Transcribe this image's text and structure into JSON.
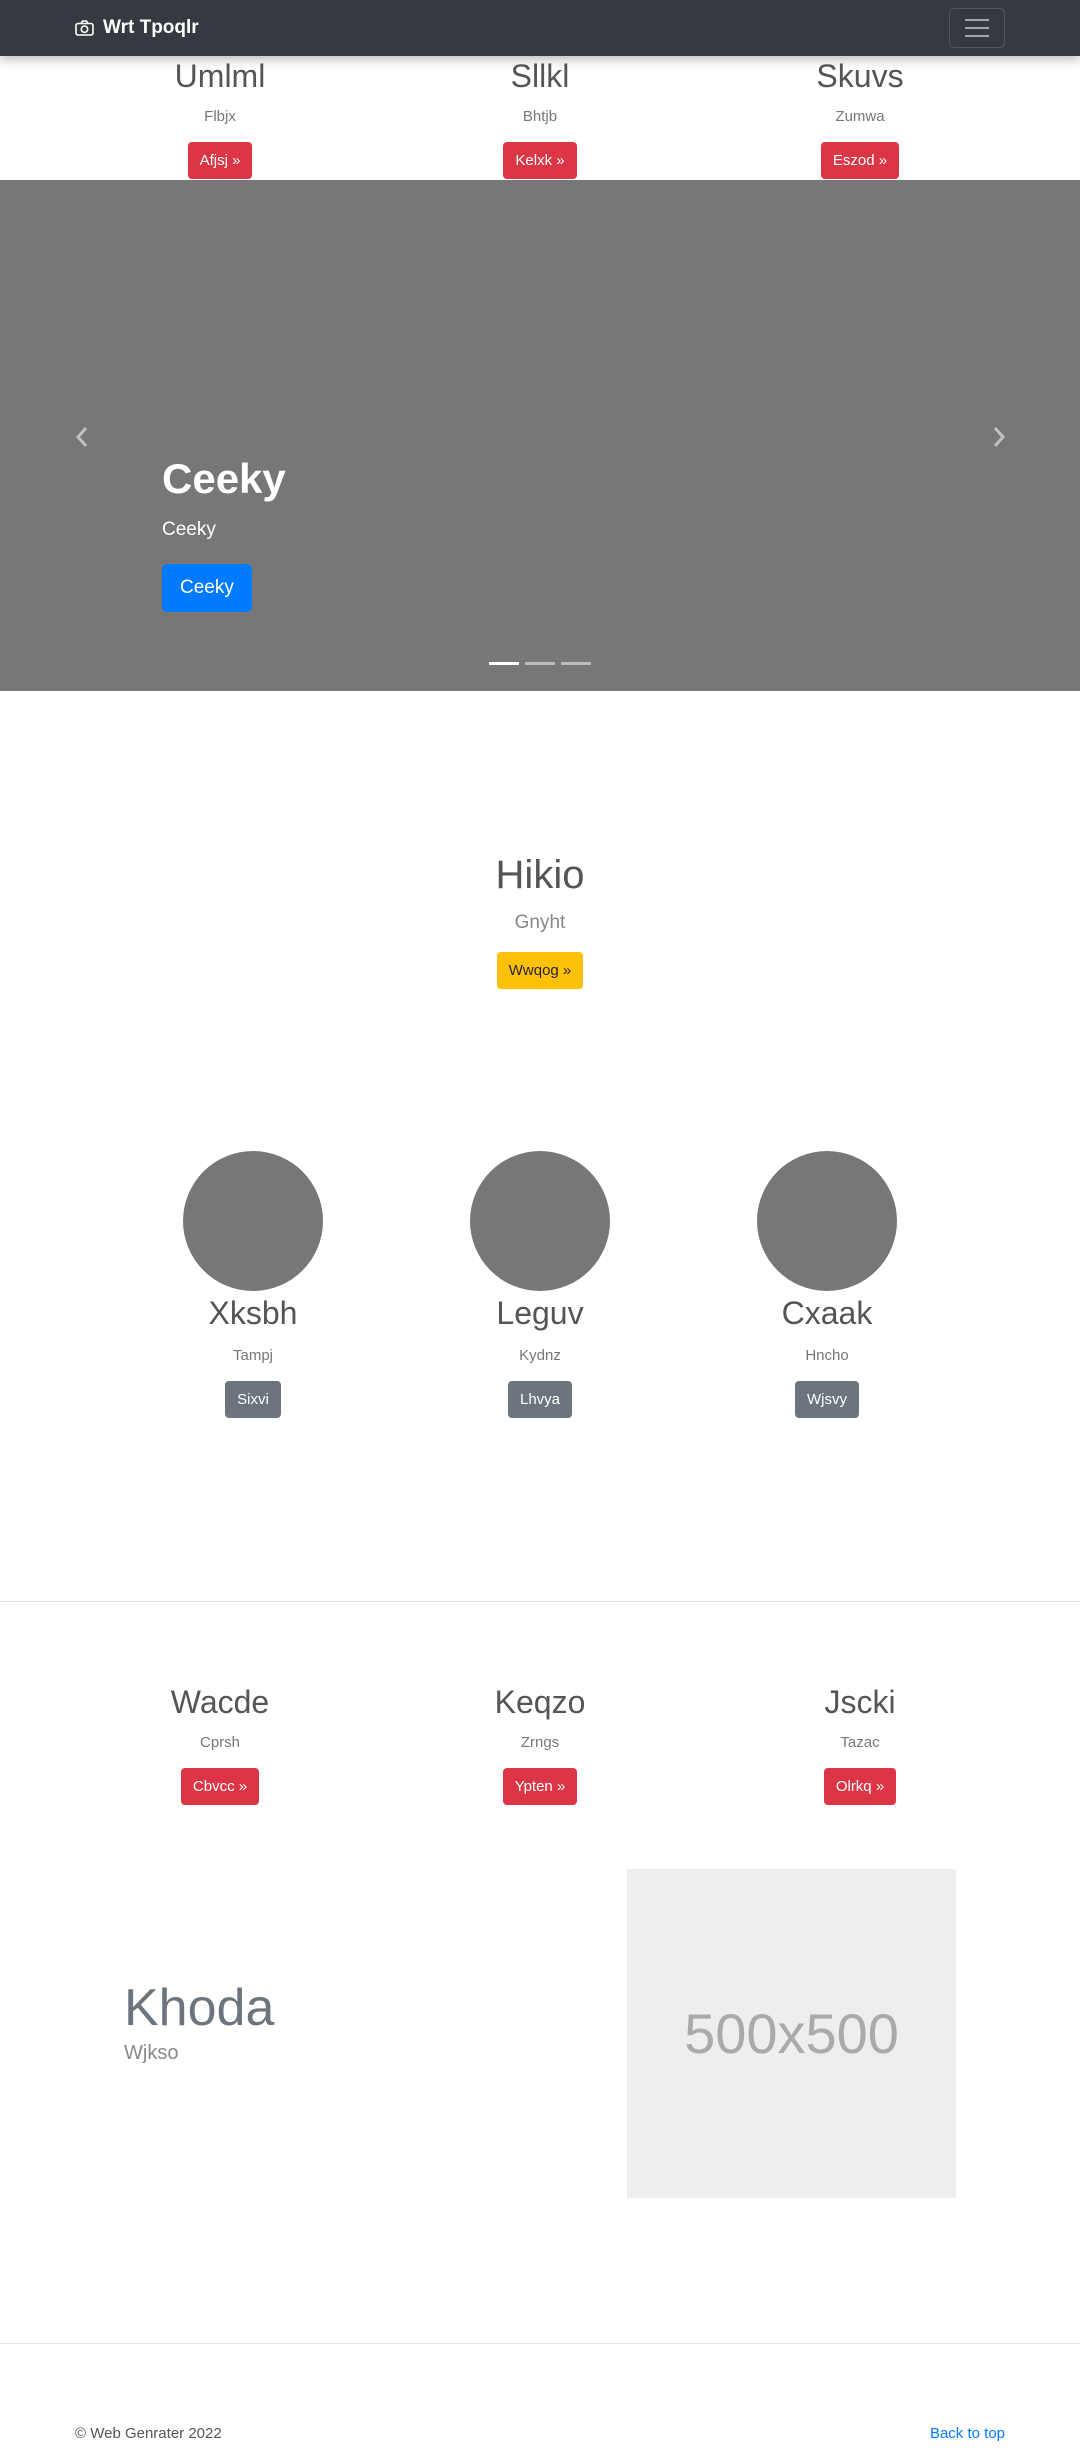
{
  "navbar": {
    "brand": "Wrt Tpoqlr",
    "brand_icon": "camera-icon",
    "toggler_icon": "hamburger-icon"
  },
  "top_features": [
    {
      "title": "Umlml",
      "subtitle": "Flbjx",
      "button": "Afjsj »"
    },
    {
      "title": "Sllkl",
      "subtitle": "Bhtjb",
      "button": "Kelxk »"
    },
    {
      "title": "Skuvs",
      "subtitle": "Zumwa",
      "button": "Eszod »"
    }
  ],
  "carousel": {
    "title": "Ceeky",
    "text": "Ceeky",
    "button": "Ceeky",
    "prev_icon": "chevron-left-icon",
    "next_icon": "chevron-right-icon",
    "slides": 3,
    "active_slide": 1
  },
  "hero": {
    "title": "Hikio",
    "subtitle": "Gnyht",
    "button": "Wwqog »"
  },
  "circles": [
    {
      "title": "Xksbh",
      "subtitle": "Tampj",
      "button": "Sixvi"
    },
    {
      "title": "Leguv",
      "subtitle": "Kydnz",
      "button": "Lhvya"
    },
    {
      "title": "Cxaak",
      "subtitle": "Hncho",
      "button": "Wjsvy"
    }
  ],
  "bottom_features": [
    {
      "title": "Wacde",
      "subtitle": "Cprsh",
      "button": "Cbvcc »"
    },
    {
      "title": "Keqzo",
      "subtitle": "Zrngs",
      "button": "Ypten »"
    },
    {
      "title": "Jscki",
      "subtitle": "Tazac",
      "button": "Olrkq »"
    }
  ],
  "feature": {
    "title": "Khoda",
    "subtitle": "Wjkso",
    "image_label": "500x500"
  },
  "footer": {
    "copyright": "© Web Genrater 2022",
    "back_to_top": "Back to top"
  },
  "colors": {
    "navbar": "#343a40",
    "red": "#dc3545",
    "gray": "#6c757d",
    "yellow": "#ffc107",
    "blue": "#007bff",
    "carousel_bg": "#777777",
    "placeholder_bg": "#eeeeee"
  }
}
